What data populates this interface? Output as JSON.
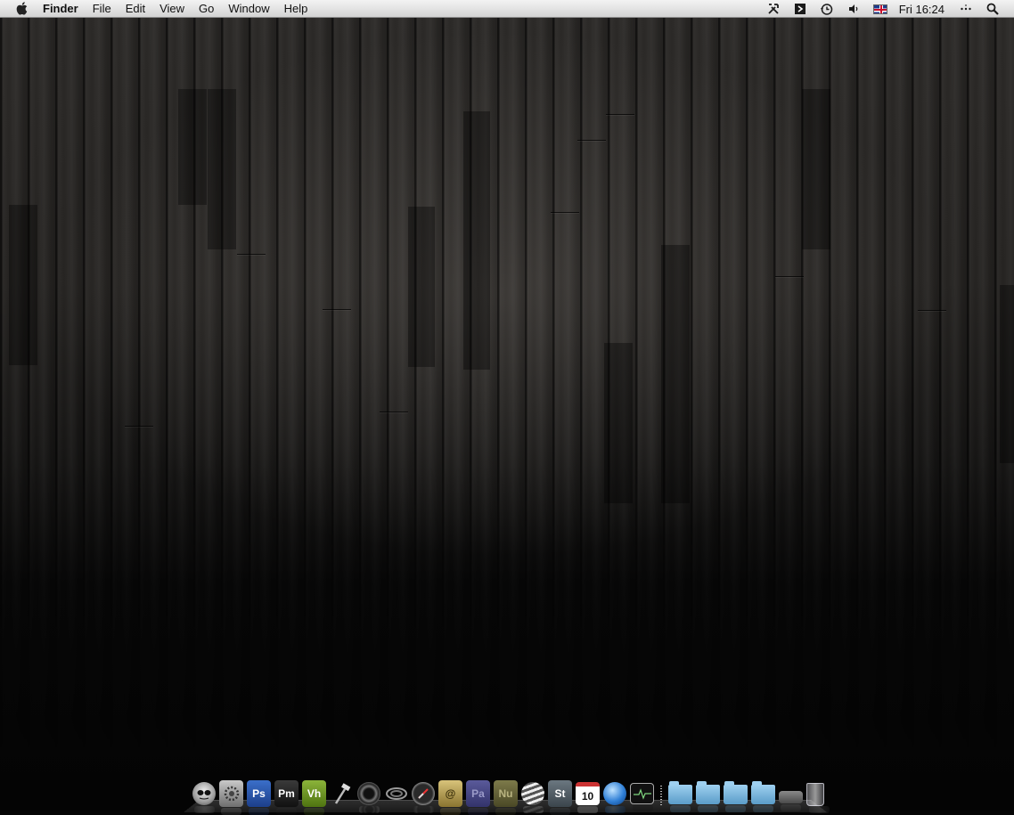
{
  "menubar": {
    "apple_icon": "apple-logo-icon",
    "app_name": "Finder",
    "menus": [
      "File",
      "Edit",
      "View",
      "Go",
      "Window",
      "Help"
    ],
    "status_icons": [
      "tools-icon",
      "script-icon",
      "time-machine-icon",
      "volume-icon",
      "uk-flag-icon"
    ],
    "clock": "Fri 16:24",
    "extra_icons": [
      "more-icon",
      "spotlight-search-icon"
    ]
  },
  "dock": {
    "items": [
      {
        "name": "skull-app-icon",
        "label": ""
      },
      {
        "name": "system-preferences-icon",
        "label": ""
      },
      {
        "name": "photoshop-icon",
        "label": "Ps"
      },
      {
        "name": "pm-app-icon",
        "label": "Pm"
      },
      {
        "name": "vh-app-icon",
        "label": "Vh"
      },
      {
        "name": "hammer-icon",
        "label": ""
      },
      {
        "name": "camera-lens-icon",
        "label": ""
      },
      {
        "name": "coil-icon",
        "label": ""
      },
      {
        "name": "compass-icon",
        "label": ""
      },
      {
        "name": "mail-icon",
        "label": "@"
      },
      {
        "name": "pa-app-icon",
        "label": "Pa"
      },
      {
        "name": "nu-app-icon",
        "label": "Nu"
      },
      {
        "name": "globe-app-icon",
        "label": ""
      },
      {
        "name": "st-app-icon",
        "label": "St"
      },
      {
        "name": "calendar-icon",
        "label": "10"
      },
      {
        "name": "safari-globe-icon",
        "label": ""
      },
      {
        "name": "activity-monitor-icon",
        "label": ""
      },
      {
        "name": "folder-downloads-icon",
        "label": ""
      },
      {
        "name": "folder-documents-icon",
        "label": ""
      },
      {
        "name": "folder-applications-icon",
        "label": ""
      },
      {
        "name": "folder-stacks-icon",
        "label": ""
      },
      {
        "name": "drive-icon",
        "label": ""
      },
      {
        "name": "trash-icon",
        "label": ""
      }
    ]
  }
}
